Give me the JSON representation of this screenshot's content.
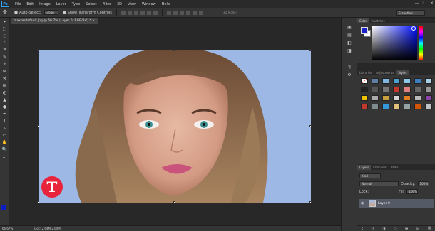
{
  "app": {
    "logo": "Ps"
  },
  "menu": [
    "File",
    "Edit",
    "Image",
    "Layer",
    "Type",
    "Select",
    "Filter",
    "3D",
    "View",
    "Window",
    "Help"
  ],
  "window_controls": [
    "—",
    "❐",
    "✕"
  ],
  "options": {
    "move_icon": "✥",
    "auto_select_label": "Auto-Select:",
    "auto_select_value": "Group",
    "show_transform_label": "Show Transform Controls",
    "mode_3d_label": "3D Mode:",
    "workspace": "Essentials"
  },
  "document": {
    "tab_title": "maxresdefault.jpg @ 66.7% (Layer 0, RGB/8#) *",
    "tab_close": "×"
  },
  "status": {
    "zoom": "66.67%",
    "doc": "Doc: 2.64M/2.64M"
  },
  "tools": [
    "▸",
    "⬚",
    "◌",
    "⟋",
    "⌗",
    "✎",
    "⚕",
    "✏",
    "⚒",
    "▤",
    "◐",
    "▲",
    "●",
    "✒",
    "T",
    "↖",
    "▭",
    "✋",
    "🔍",
    "…"
  ],
  "strip_icons": [
    "▣",
    "▤",
    "◧",
    "◨",
    "¶",
    "⚙"
  ],
  "panels": {
    "color_tabs": [
      "Color",
      "Swatches"
    ],
    "style_tabs": [
      "Libraries",
      "Adjustments",
      "Styles"
    ],
    "layers_tabs": [
      "Layers",
      "Channels",
      "Paths"
    ],
    "kind_label": "Kind",
    "blend_mode": "Normal",
    "opacity_label": "Opacity:",
    "opacity_value": "100%",
    "lock_label": "Lock:",
    "fill_label": "Fill:",
    "fill_value": "100%",
    "layer_name": "Layer 0",
    "footer_icons": [
      "ɕ",
      "fx",
      "◑",
      "▭",
      "▬",
      "⊞",
      "🗑"
    ]
  },
  "colors": {
    "foreground": "#1d22c8",
    "background": "#ffffff",
    "accent": "#31a8ff"
  },
  "watermark_letter": "T"
}
